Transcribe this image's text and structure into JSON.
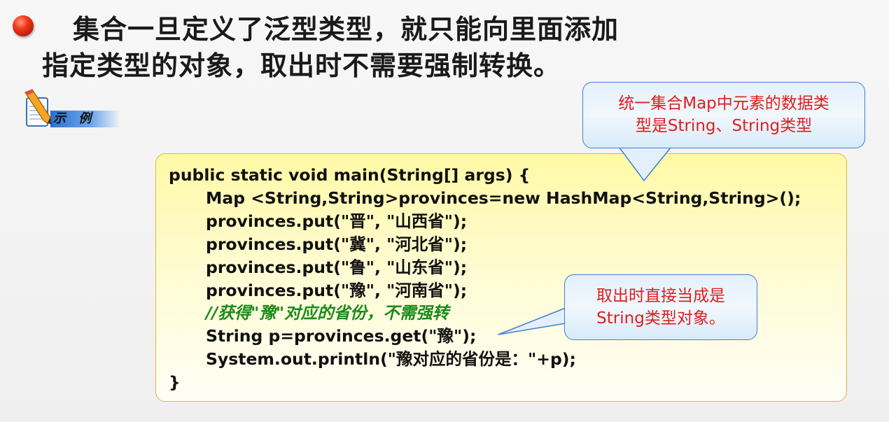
{
  "heading": {
    "line1": "集合一旦定义了泛型类型，就只能向里面添加",
    "line2": "指定类型的对象，取出时不需要强制转换。"
  },
  "example_badge": {
    "label": "示 例"
  },
  "code": {
    "lines": [
      "public static void main(String[] args) {",
      "Map <String,String>provinces=new HashMap<String,String>();",
      "provinces.put(\"晋\", \"山西省\");",
      "provinces.put(\"冀\", \"河北省\");",
      "provinces.put(\"鲁\", \"山东省\");",
      "provinces.put(\"豫\", \"河南省\");",
      "//获得\"豫\"对应的省份，不需强转",
      "String p=provinces.get(\"豫\");",
      "System.out.println(\"豫对应的省份是：\"+p);",
      "}"
    ]
  },
  "callouts": {
    "map_types": {
      "line1": "统一集合Map中元素的数据类",
      "line2": "型是String、String类型"
    },
    "get_result": {
      "line1": "取出时直接当成是",
      "line2": "String类型对象。"
    }
  },
  "colors": {
    "callout_text": "#e01e1e",
    "comment_text": "#1b8a1b",
    "code_box_border": "#e8b23a",
    "callout_border": "#3d7fd6"
  }
}
